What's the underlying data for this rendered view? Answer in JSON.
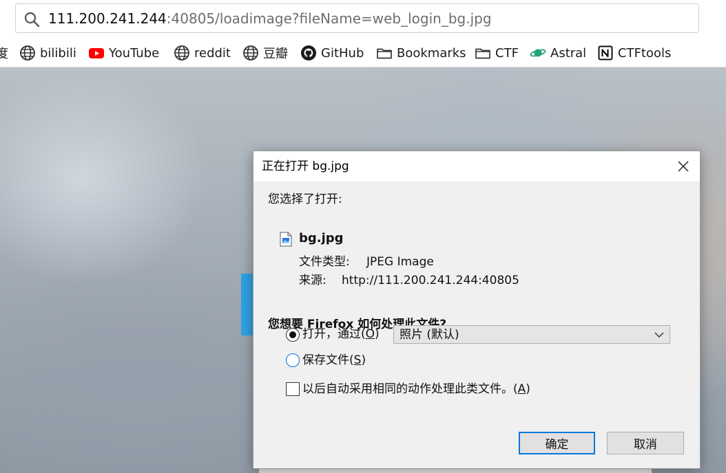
{
  "url_bar": {
    "host": "111.200.241.244",
    "rest": ":40805/loadimage?fileName=web_login_bg.jpg"
  },
  "bookmarks": [
    {
      "label": "度",
      "icon": "baidu-icon"
    },
    {
      "label": "bilibili",
      "icon": "globe-icon"
    },
    {
      "label": "YouTube",
      "icon": "youtube-icon"
    },
    {
      "label": "reddit",
      "icon": "globe-icon"
    },
    {
      "label": "豆瓣",
      "icon": "globe-icon"
    },
    {
      "label": "GitHub",
      "icon": "github-icon"
    },
    {
      "label": "Bookmarks",
      "icon": "folder-icon"
    },
    {
      "label": "CTF",
      "icon": "folder-icon"
    },
    {
      "label": "Astral",
      "icon": "planet-icon"
    },
    {
      "label": "CTFtools",
      "icon": "notion-icon"
    }
  ],
  "dialog": {
    "title": "正在打开 bg.jpg",
    "intro": "您选择了打开:",
    "file_name": "bg.jpg",
    "file_type_label": "文件类型:",
    "file_type_value": "JPEG Image",
    "source_label": "来源:",
    "source_value": "http://111.200.241.244:40805",
    "question": "您想要 Firefox 如何处理此文件?",
    "open_with_label": "打开，通过",
    "open_with_key": "O",
    "open_with_app": "照片 (默认)",
    "save_file_label": "保存文件",
    "save_file_key": "S",
    "auto_label": "以后自动采用相同的动作处理此类文件。",
    "auto_key": "A",
    "ok_button": "确定",
    "cancel_button": "取消"
  },
  "colors": {
    "accent": "#0078d7",
    "page_blue_bar": "#2ea3e3"
  }
}
